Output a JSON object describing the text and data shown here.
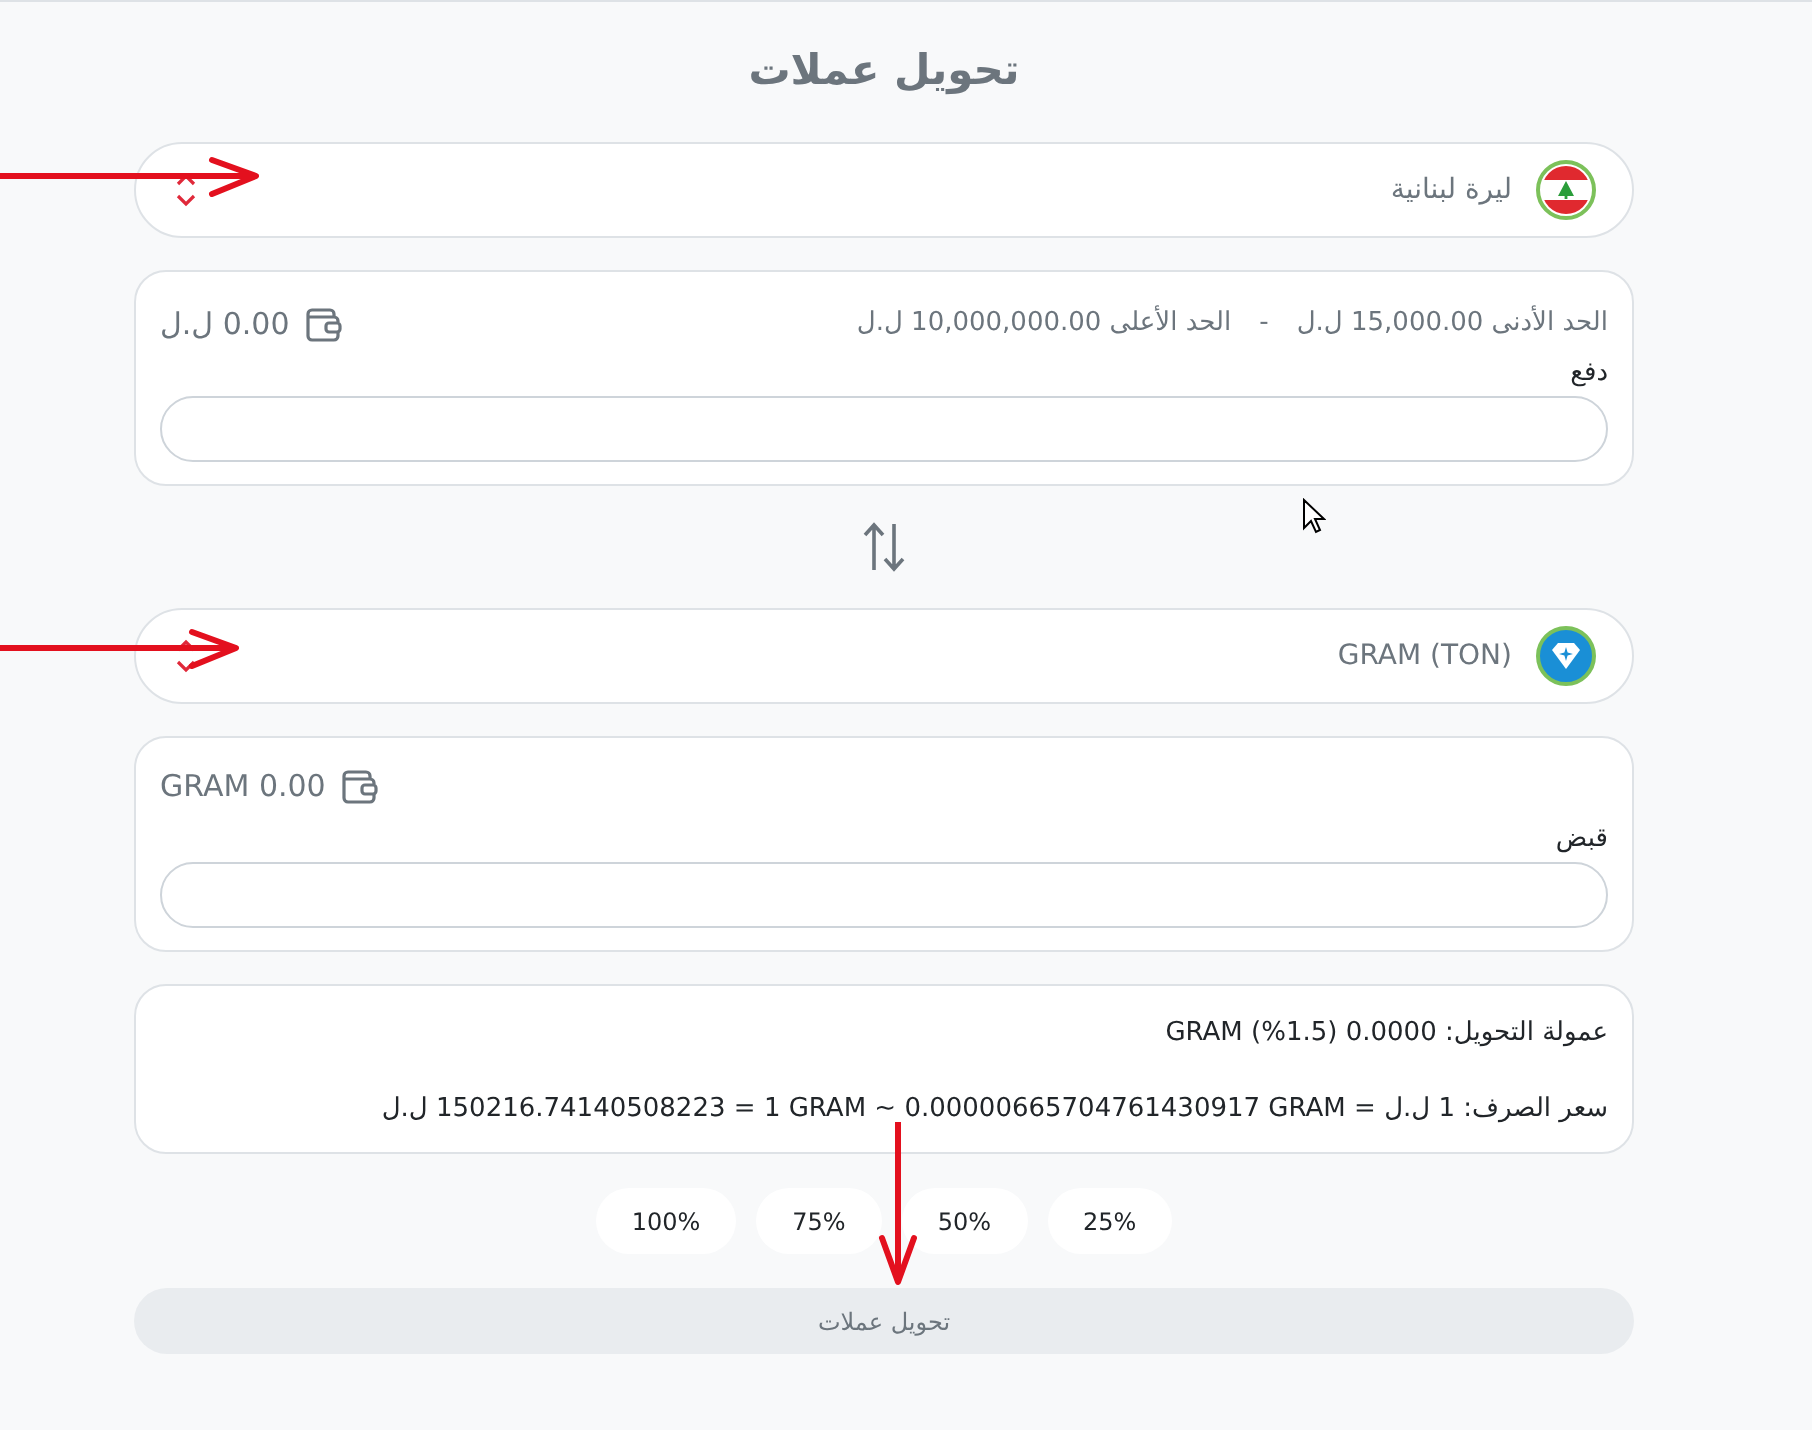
{
  "title": "تحويل عملات",
  "from_currency": {
    "label": "ليرة لبنانية"
  },
  "pay": {
    "min_limit": "الحد الأدنى 15,000.00 ل.ل",
    "separator": "-",
    "max_limit": "الحد الأعلى 10,000,000.00 ل.ل",
    "balance": "0.00 ل.ل",
    "field_label": "دفع"
  },
  "to_currency": {
    "label": "GRAM (TON)"
  },
  "receive": {
    "balance": "0.00 GRAM",
    "field_label": "قبض"
  },
  "summary": {
    "commission": "عمولة التحويل: 0.0000 (1.5%) GRAM",
    "rate_parts": [
      "سعر الصرف:",
      "1 ل.ل",
      "=",
      "0.00000665704761430917 GRAM",
      "~",
      "1 GRAM",
      "=",
      "150216.74140508223 ل.ل"
    ]
  },
  "percent_buttons": [
    {
      "label": "25%"
    },
    {
      "label": "50%"
    },
    {
      "label": "75%"
    },
    {
      "label": "100%"
    }
  ],
  "submit_button": {
    "label": "تحويل عملات",
    "disabled": true
  }
}
